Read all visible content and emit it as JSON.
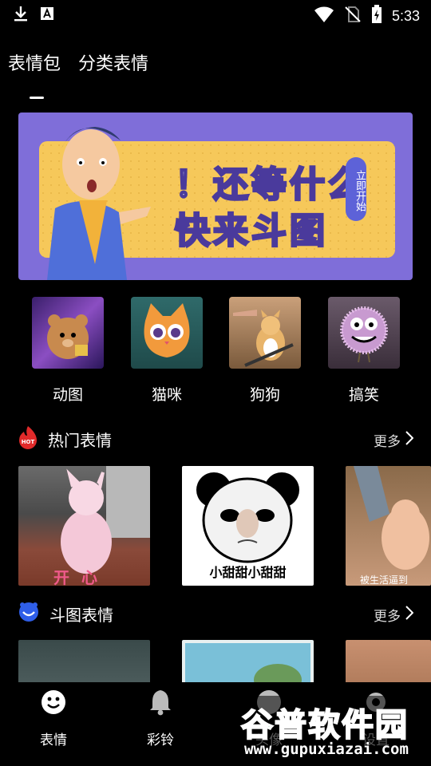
{
  "status_bar": {
    "time": "5:33",
    "icons": [
      "download-icon",
      "font-a-icon",
      "wifi-icon",
      "no-sim-icon",
      "battery-charging-icon"
    ]
  },
  "top_tabs": [
    {
      "label": "表情包",
      "active": true
    },
    {
      "label": "分类表情",
      "active": false
    }
  ],
  "banner": {
    "line1": "！还等什么",
    "line2": "快来斗图",
    "tag": "立即开始"
  },
  "categories": [
    {
      "label": "动图",
      "icon": "bear-icon"
    },
    {
      "label": "猫咪",
      "icon": "cat-icon"
    },
    {
      "label": "狗狗",
      "icon": "dog-icon"
    },
    {
      "label": "搞笑",
      "icon": "fuzzball-icon"
    }
  ],
  "sections": [
    {
      "title": "热门表情",
      "icon": "hot-icon",
      "icon_label": "HOT",
      "more": "更多",
      "cards": [
        {
          "caption": "开 心",
          "kind": "baby-photo"
        },
        {
          "caption": "小甜甜小甜甜",
          "kind": "panda-meme"
        },
        {
          "caption": "被生活逼到",
          "kind": "child-photo"
        }
      ]
    },
    {
      "title": "斗图表情",
      "icon": "smile-face-icon",
      "more": "更多",
      "cards": [
        {
          "caption": "",
          "kind": "photo"
        },
        {
          "caption": "",
          "kind": "cartoon"
        },
        {
          "caption": "",
          "kind": "photo"
        }
      ]
    }
  ],
  "bottom_nav": [
    {
      "label": "表情",
      "icon": "smiley-icon",
      "active": true
    },
    {
      "label": "彩铃",
      "icon": "bell-icon",
      "active": false
    },
    {
      "label": "头像",
      "icon": "avatar-icon",
      "active": false
    },
    {
      "label": "设置",
      "icon": "gear-icon",
      "active": false
    }
  ],
  "watermark": {
    "title": "谷普软件园",
    "url": "www.gupuxiazai.com"
  }
}
